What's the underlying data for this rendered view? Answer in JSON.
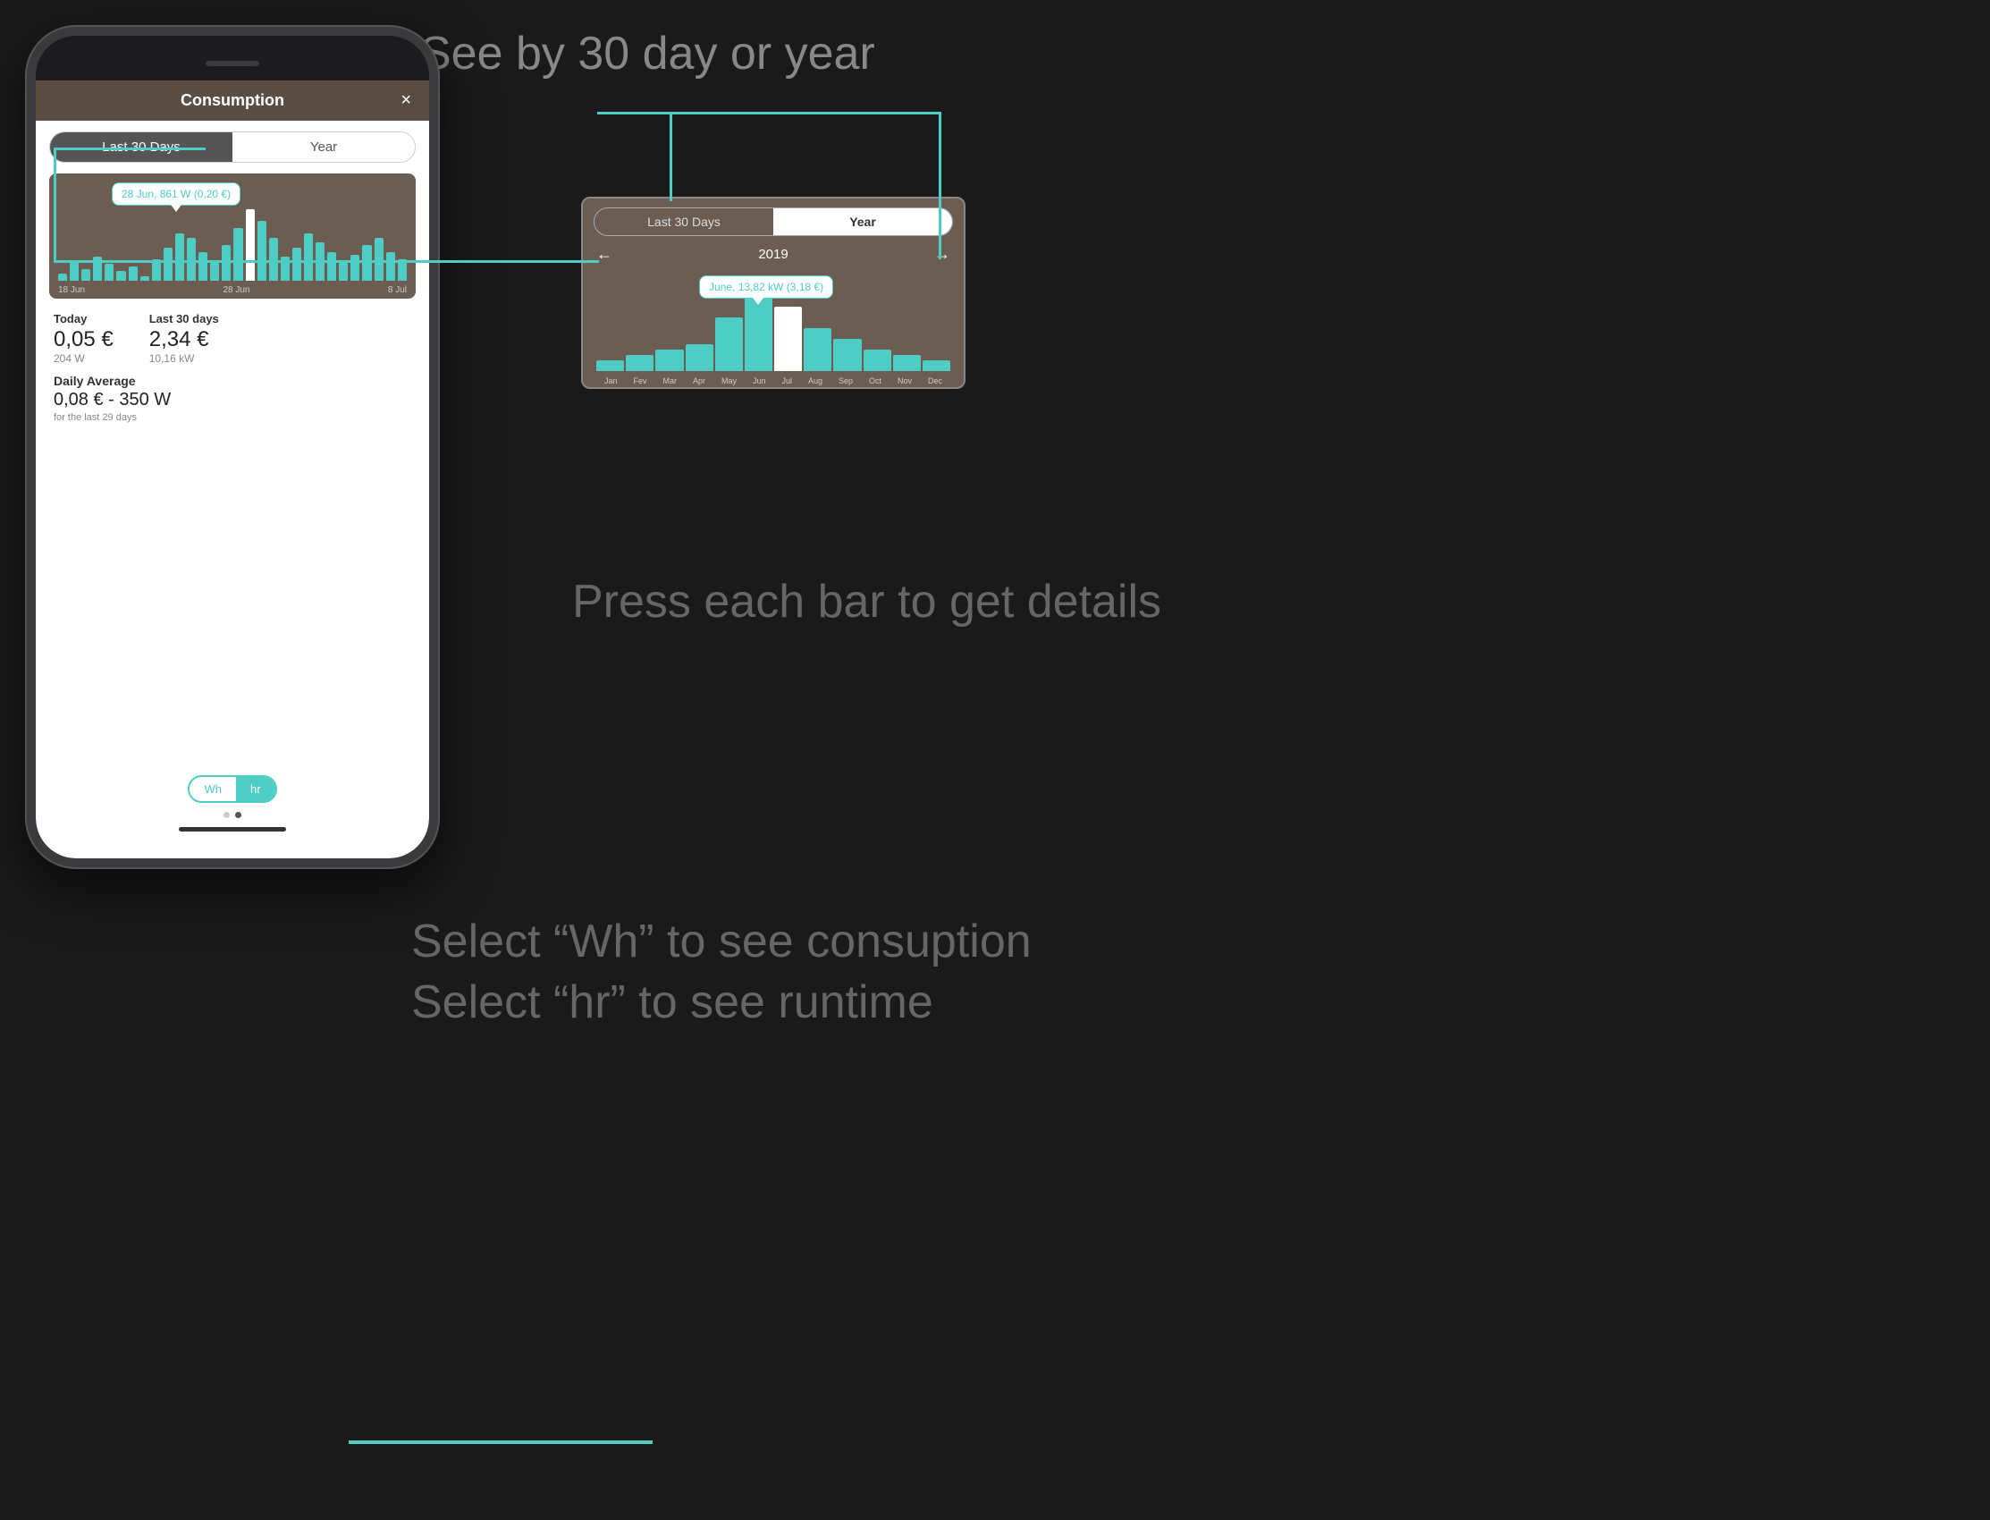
{
  "page": {
    "background": "#1a1a1a"
  },
  "annotations": {
    "see_by": "See by 30 day or year",
    "press_bar": "Press each bar\nto get details",
    "select_wh": "Select “Wh” to see consuption",
    "select_hr": "Select “hr” to see runtime"
  },
  "phone": {
    "header": {
      "title": "Consumption",
      "close": "×"
    },
    "tabs": {
      "option1": "Last 30 Days",
      "option2": "Year",
      "active": "option1"
    },
    "chart_tooltip": "28 Jun, 861 W (0,20 €)",
    "chart_labels": {
      "left": "18 Jun",
      "mid": "28 Jun",
      "right": "8 Jul"
    },
    "bars": [
      3,
      8,
      5,
      10,
      7,
      4,
      6,
      2,
      9,
      14,
      20,
      18,
      12,
      8,
      15,
      22,
      30,
      25,
      18,
      10,
      14,
      20,
      16,
      12,
      8,
      11,
      15,
      18,
      12,
      9
    ],
    "stats": {
      "today_label": "Today",
      "today_value": "0,05 €",
      "today_sub": "204 W",
      "last30_label": "Last 30 days",
      "last30_value": "2,34 €",
      "last30_sub": "10,16 kW",
      "daily_avg_label": "Daily Average",
      "daily_avg_value": "0,08 € - 350 W",
      "daily_avg_sub": "for the last 29 days"
    },
    "bottom": {
      "wh": "Wh",
      "hr": "hr"
    }
  },
  "year_panel": {
    "tabs": {
      "option1": "Last 30 Days",
      "option2": "Year",
      "active": "option2"
    },
    "nav": {
      "left": "←",
      "year": "2019",
      "right": "→"
    },
    "tooltip": "June, 13,82 kW (3,18 €)",
    "bars": [
      2,
      3,
      4,
      5,
      10,
      15,
      12,
      8,
      6,
      4,
      3,
      2
    ],
    "highlight_index": 7,
    "months": [
      "Jan",
      "Fev",
      "Mar",
      "Apr",
      "May",
      "Jun",
      "Jul",
      "Aug",
      "Sep",
      "Oct",
      "Nov",
      "Dec"
    ]
  }
}
